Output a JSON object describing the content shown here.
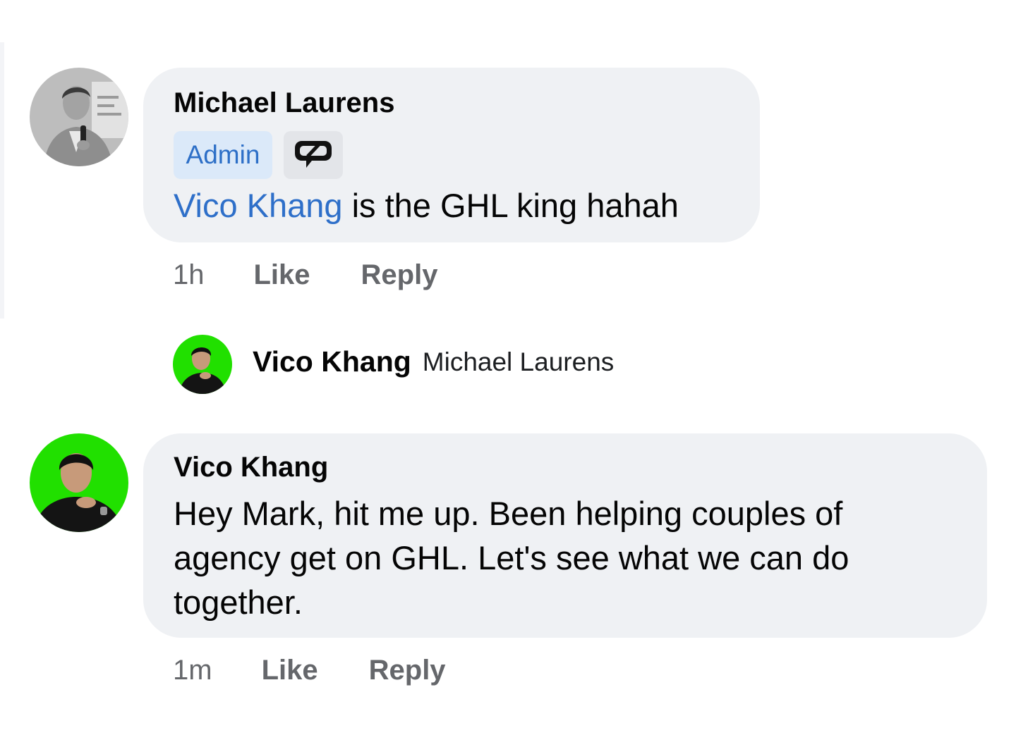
{
  "comments": [
    {
      "author": "Michael Laurens",
      "badge": "Admin",
      "badge_icon": "top-commenter-icon",
      "mention": "Vico Khang",
      "text": " is the GHL king hahah",
      "time": "1h",
      "like_label": "Like",
      "reply_label": "Reply"
    },
    {
      "author": "Vico Khang",
      "text_lines": [
        "Hey Mark, hit me up. Been helping couples of",
        "agency get on GHL. Let's see what we can do",
        "together."
      ],
      "time": "1m",
      "like_label": "Like",
      "reply_label": "Reply"
    }
  ],
  "reply_preview": {
    "author": "Vico Khang",
    "snippet": "Michael Laurens"
  },
  "colors": {
    "bubble": "#eff1f4",
    "mention": "#2e6fc9",
    "admin_badge_bg": "#dbe9f9",
    "admin_badge_text": "#2d6fc7",
    "action_text": "#65676b",
    "green_screen": "#21e000"
  }
}
